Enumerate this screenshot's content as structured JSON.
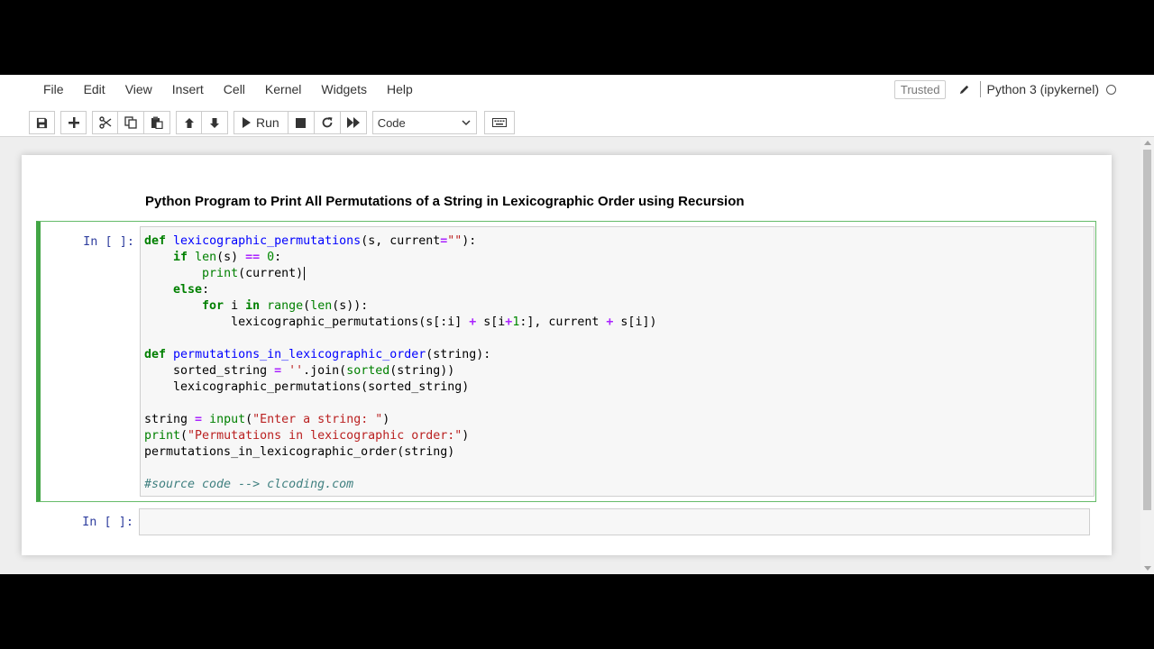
{
  "menubar": {
    "items": [
      "File",
      "Edit",
      "View",
      "Insert",
      "Cell",
      "Kernel",
      "Widgets",
      "Help"
    ]
  },
  "status": {
    "trusted": "Trusted",
    "kernel_name": "Python 3 (ipykernel)"
  },
  "toolbar": {
    "run_label": "Run",
    "cell_type": "Code",
    "cell_type_options": [
      "Code"
    ]
  },
  "notebook": {
    "markdown_title": "Python Program to Print All Permutations of a String in Lexicographic Order using Recursion",
    "cells": [
      {
        "prompt": "In [ ]:",
        "code": [
          "def lexicographic_permutations(s, current=\"\"):",
          "    if len(s) == 0:",
          "        print(current)",
          "    else:",
          "        for i in range(len(s)):",
          "            lexicographic_permutations(s[:i] + s[i+1:], current + s[i])",
          "",
          "def permutations_in_lexicographic_order(string):",
          "    sorted_string = ''.join(sorted(string))",
          "    lexicographic_permutations(sorted_string)",
          "",
          "string = input(\"Enter a string: \")",
          "print(\"Permutations in lexicographic order:\")",
          "permutations_in_lexicographic_order(string)",
          "",
          "#source code --> clcoding.com"
        ]
      },
      {
        "prompt": "In [ ]:",
        "code": []
      }
    ]
  },
  "colors": {
    "selected_border": "#42a545",
    "prompt": "#303f9f"
  },
  "icons": [
    "save-icon",
    "plus-icon",
    "scissors-icon",
    "copy-icon",
    "paste-icon",
    "arrow-up-icon",
    "arrow-down-icon",
    "play-icon",
    "stop-icon",
    "restart-icon",
    "fast-forward-icon",
    "keyboard-icon",
    "pencil-icon",
    "kernel-idle-icon"
  ]
}
